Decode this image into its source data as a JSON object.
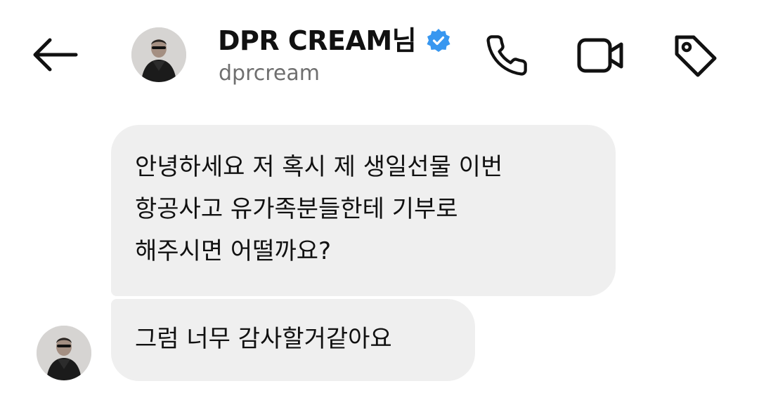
{
  "header": {
    "name": "DPR CREAM님",
    "username": "dprcream",
    "verified_color": "#3897F0",
    "icons": {
      "back": "arrow-left-icon",
      "call": "phone-icon",
      "video": "video-camera-icon",
      "tag": "tag-icon"
    }
  },
  "messages": [
    {
      "from": "contact",
      "text": "안녕하세요 저 혹시 제 생일선물 이번\n항공사고 유가족분들한테 기부로\n해주시면 어떨까요?"
    },
    {
      "from": "contact",
      "text": "그럼 너무 감사할거같아요"
    }
  ],
  "colors": {
    "bubble": "#EFEFEF",
    "text": "#111111",
    "secondary_text": "#6F6F6F"
  }
}
